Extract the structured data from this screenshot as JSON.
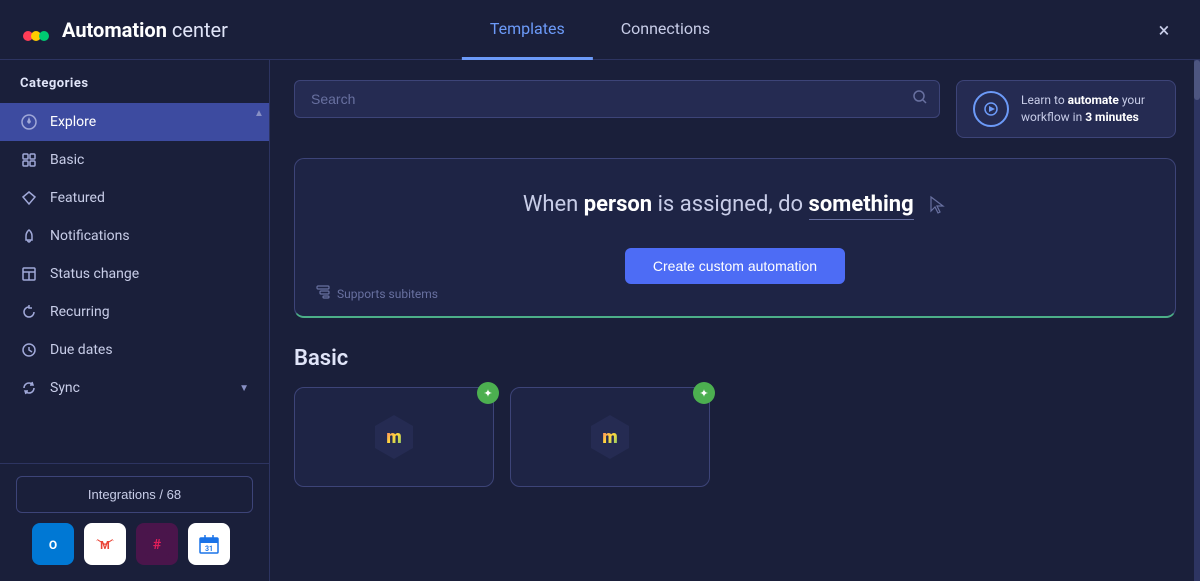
{
  "header": {
    "app_name_bold": "Automation",
    "app_name_rest": " center",
    "tabs": [
      {
        "id": "templates",
        "label": "Templates",
        "active": true
      },
      {
        "id": "connections",
        "label": "Connections",
        "active": false
      }
    ],
    "close_label": "×"
  },
  "learn_card": {
    "text_before": "Learn to ",
    "text_bold": "automate",
    "text_after": " your workflow in ",
    "minutes": "3 minutes"
  },
  "search": {
    "placeholder": "Search"
  },
  "sidebar": {
    "categories_label": "Categories",
    "items": [
      {
        "id": "explore",
        "label": "Explore",
        "active": true,
        "icon": "compass"
      },
      {
        "id": "basic",
        "label": "Basic",
        "active": false,
        "icon": "grid"
      },
      {
        "id": "featured",
        "label": "Featured",
        "active": false,
        "icon": "diamond"
      },
      {
        "id": "notifications",
        "label": "Notifications",
        "active": false,
        "icon": "bell"
      },
      {
        "id": "status-change",
        "label": "Status change",
        "active": false,
        "icon": "table"
      },
      {
        "id": "recurring",
        "label": "Recurring",
        "active": false,
        "icon": "refresh"
      },
      {
        "id": "due-dates",
        "label": "Due dates",
        "active": false,
        "icon": "clock"
      },
      {
        "id": "sync",
        "label": "Sync",
        "active": false,
        "icon": "sync",
        "has_chevron": true
      }
    ],
    "integrations_button": "Integrations / 68",
    "integration_icons": [
      {
        "id": "outlook",
        "color": "#0078d4",
        "symbol": "📧"
      },
      {
        "id": "gmail",
        "color": "#ea4335",
        "symbol": "M"
      },
      {
        "id": "slack",
        "color": "#4a154b",
        "symbol": "#"
      },
      {
        "id": "gcal",
        "color": "#1a73e8",
        "symbol": "📅"
      }
    ]
  },
  "custom_automation": {
    "sentence_before": "When ",
    "trigger": "person",
    "sentence_middle": " is assigned, do ",
    "action": "something",
    "supports_subitems": "Supports subitems",
    "create_button": "Create custom automation"
  },
  "basic_section": {
    "title": "Basic",
    "cards": [
      {
        "id": "card1",
        "has_badge": true,
        "badge_icon": "✦"
      },
      {
        "id": "card2",
        "has_badge": true,
        "badge_icon": "✦"
      }
    ]
  }
}
